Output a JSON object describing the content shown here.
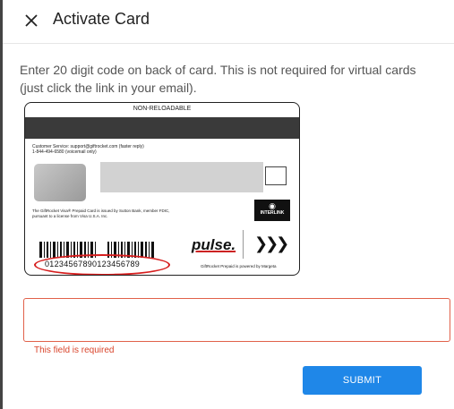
{
  "dialog": {
    "title": "Activate Card",
    "close_icon": "close-icon",
    "instructions": "Enter 20 digit code on back of card. This is not required for virtual cards (just click the link in your email)."
  },
  "card_image": {
    "header_label": "NON-RELOADABLE",
    "customer_service": "Customer Service: support@giftrocket.com (faster reply)\n1-844-494-6580 (voicemail only)",
    "legal_text": "The GiftRocket Visa® Prepaid Card is issued by Sutton Bank, member FDIC, pursuant to a license from Visa U.S.A. Inc.",
    "interlink_label": "INTERLINK",
    "card_number": "01234567890123456789",
    "pulse_label": "pulse.",
    "powered_by": "GiftRocket Prepaid is powered by Margeta"
  },
  "form": {
    "code_value": "",
    "error_message": "This field is required",
    "submit_label": "SUBMIT"
  },
  "colors": {
    "accent": "#1f87e8",
    "error": "#d9442b",
    "highlight_oval": "#d61d1d"
  }
}
